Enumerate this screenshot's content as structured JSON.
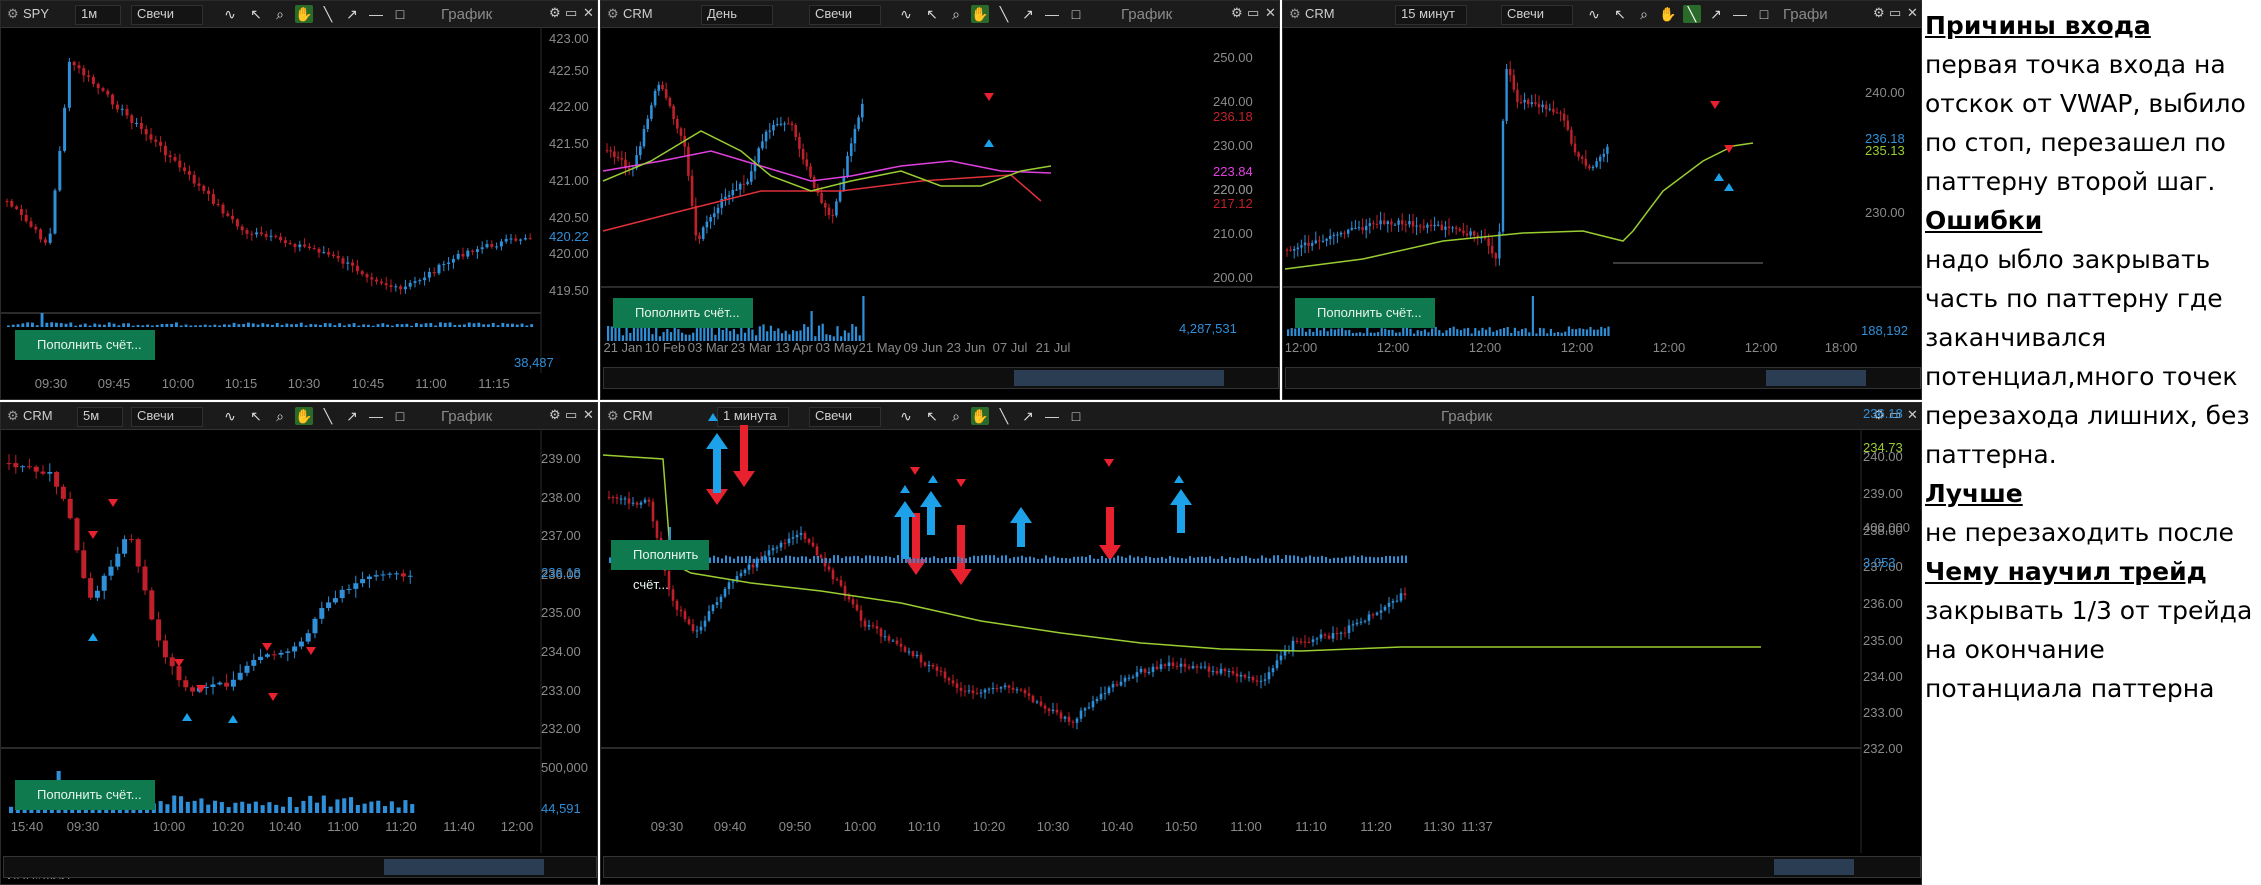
{
  "panels": {
    "p1": {
      "symbol": "SPY",
      "interval": "1м",
      "type": "Свечи",
      "title": "График",
      "yticks": [
        "423.00",
        "422.50",
        "422.00",
        "421.50",
        "421.00",
        "420.50",
        "420.00",
        "419.50"
      ],
      "xticks": [
        "09:30",
        "09:45",
        "10:00",
        "10:15",
        "10:30",
        "10:45",
        "11:00",
        "11:15"
      ],
      "price_tag": "420.22",
      "vol_tag": "38,487",
      "button": "Пополнить счёт..."
    },
    "p2": {
      "symbol": "CRM",
      "interval": "День",
      "type": "Свечи",
      "title": "График",
      "yticks": [
        "250.00",
        "240.00",
        "230.00",
        "220.00",
        "210.00",
        "200.00"
      ],
      "tags": [
        "236.18",
        "223.84",
        "220.00",
        "217.12"
      ],
      "xticks": [
        "21 Jan",
        "10 Feb",
        "03 Mar",
        "23 Mar",
        "13 Apr",
        "03 May",
        "21 May",
        "09 Jun",
        "23 Jun",
        "07 Jul",
        "21 Jul"
      ],
      "vol_tag": "4,287,531",
      "button": "Пополнить счёт..."
    },
    "p3": {
      "symbol": "CRM",
      "interval": "15 минут",
      "type": "Свечи",
      "title": "Графи",
      "yticks": [
        "240.00",
        "230.00"
      ],
      "tags": [
        "236.18",
        "235.13"
      ],
      "xticks": [
        "12:00",
        "12:00",
        "12:00",
        "12:00",
        "12:00",
        "12:00",
        "18:00"
      ],
      "vol_tag": "188,192",
      "button": "Пополнить счёт..."
    },
    "p4": {
      "symbol": "CRM",
      "interval": "5м",
      "type": "Свечи",
      "title": "График",
      "yticks": [
        "239.00",
        "238.00",
        "237.00",
        "236.00",
        "235.00",
        "234.00",
        "233.00",
        "232.00"
      ],
      "price_tag": "236.18",
      "xticks": [
        "15:40",
        "09:30",
        "10:00",
        "10:20",
        "10:40",
        "11:00",
        "11:20",
        "11:40",
        "12:00"
      ],
      "vol_ticks": [
        "500,000"
      ],
      "vol_tag": "44,591",
      "button": "Пополнить счёт..."
    },
    "p5": {
      "symbol": "CRM",
      "interval": "1 минута",
      "type": "Свечи",
      "title": "График",
      "yticks": [
        "240.00",
        "239.00",
        "238.00",
        "237.00",
        "236.00",
        "235.00",
        "234.00",
        "233.00",
        "232.00"
      ],
      "tags": [
        "236.18",
        "234.73"
      ],
      "xticks": [
        "09:30",
        "09:40",
        "09:50",
        "10:00",
        "10:10",
        "10:20",
        "10:30",
        "10:40",
        "10:50",
        "11:00",
        "11:10",
        "11:20",
        "11:30",
        "11:37"
      ],
      "vol_ticks": [
        "400,000"
      ],
      "vol_tag": "3,053",
      "button": "Пополнить счёт..."
    }
  },
  "toolbar": {
    "tool_icons": [
      "cursor-icon",
      "magnifier-icon",
      "hand-icon",
      "line-icon",
      "arrow-icon",
      "hline-icon",
      "rect-icon"
    ]
  },
  "bottom_left_text": "ИНН#...ЛЛ",
  "colors": {
    "up": "#2f8fd8",
    "down": "#c0202a",
    "arrow_red": "#e8212e",
    "arrow_blue": "#1da1e8",
    "vwap": "#9acd32",
    "ma_magenta": "#e040e0",
    "ma_red": "#e0303a"
  },
  "notes": [
    {
      "kind": "h",
      "text": "Причины входа"
    },
    {
      "kind": "t",
      "text": "первая точка входа на"
    },
    {
      "kind": "t",
      "text": "отскок от VWAP, выбило"
    },
    {
      "kind": "t",
      "text": "по стоп, перезашел по"
    },
    {
      "kind": "t",
      "text": "паттерну второй шаг."
    },
    {
      "kind": "h",
      "text": "Ошибки"
    },
    {
      "kind": "t",
      "text": "надо ыбло закрывать"
    },
    {
      "kind": "t",
      "text": "часть по паттерну где"
    },
    {
      "kind": "t",
      "text": "заканчивался"
    },
    {
      "kind": "t",
      "text": "потенциал,много точек"
    },
    {
      "kind": "t",
      "text": "перезахода лишних, без"
    },
    {
      "kind": "t",
      "text": "паттерна."
    },
    {
      "kind": "h",
      "text": "Лучше"
    },
    {
      "kind": "t",
      "text": "не перезаходить после"
    },
    {
      "kind": "h",
      "text": "Чему научил трейд"
    },
    {
      "kind": "t",
      "text": "закрывать 1/3 от трейда"
    },
    {
      "kind": "t",
      "text": "на окончание"
    },
    {
      "kind": "t",
      "text": "потанциала паттерна"
    }
  ]
}
